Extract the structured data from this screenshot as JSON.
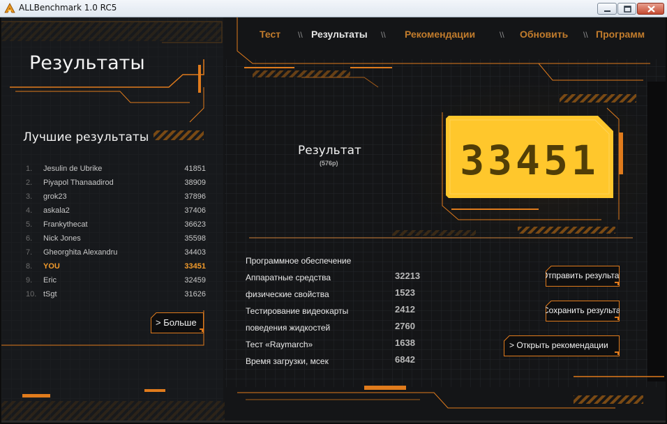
{
  "window": {
    "title": "ALLBenchmark 1.0 RC5"
  },
  "colors": {
    "accent": "#f29b2b",
    "score_box": "#ffc72c",
    "frame_orange": "#e07b1c",
    "background": "#121315"
  },
  "header": {
    "heading": "Результаты"
  },
  "nav": {
    "items": [
      {
        "label": "Тест",
        "active": false
      },
      {
        "label": "Результаты",
        "active": true
      },
      {
        "label": "Рекомендации",
        "active": false
      },
      {
        "label": "Обновить",
        "active": false
      },
      {
        "label": "Программ",
        "active": false
      }
    ],
    "separator": "\\\\"
  },
  "leaderboard": {
    "title": "Лучшие результаты",
    "rows": [
      {
        "rank": "1.",
        "name": "Jesulin de Ubrike",
        "score": "41851"
      },
      {
        "rank": "2.",
        "name": "Piyapol Thanaadirod",
        "score": "38909"
      },
      {
        "rank": "3.",
        "name": "grok23",
        "score": "37896"
      },
      {
        "rank": "4.",
        "name": "askala2",
        "score": "37406"
      },
      {
        "rank": "5.",
        "name": "Frankythecat",
        "score": "36623"
      },
      {
        "rank": "6.",
        "name": "Nick Jones",
        "score": "35598"
      },
      {
        "rank": "7.",
        "name": "Gheorghita Alexandru",
        "score": "34403"
      },
      {
        "rank": "8.",
        "name": "YOU",
        "score": "33451",
        "highlight": true
      },
      {
        "rank": "9.",
        "name": "Eric",
        "score": "32459"
      },
      {
        "rank": "10.",
        "name": "tSgt",
        "score": "31626"
      }
    ],
    "more_label": "> Больше"
  },
  "result": {
    "label": "Результат",
    "resolution": "(576p)",
    "score": "33451"
  },
  "stats": [
    {
      "label": "Программное обеспечение",
      "value": ""
    },
    {
      "label": "Аппаратные средства",
      "value": "32213"
    },
    {
      "label": "физические свойства",
      "value": "1523"
    },
    {
      "label": "Тестирование видеокарты",
      "value": "2412"
    },
    {
      "label": "поведения жидкостей",
      "value": "2760"
    },
    {
      "label": "Тест «Raymarch»",
      "value": "1638"
    },
    {
      "label": "Время загрузки, мсек",
      "value": "6842"
    }
  ],
  "actions": {
    "send": "Отправить результат",
    "save": "Сохранить результат",
    "open_recs": "> Открыть рекомендации"
  }
}
